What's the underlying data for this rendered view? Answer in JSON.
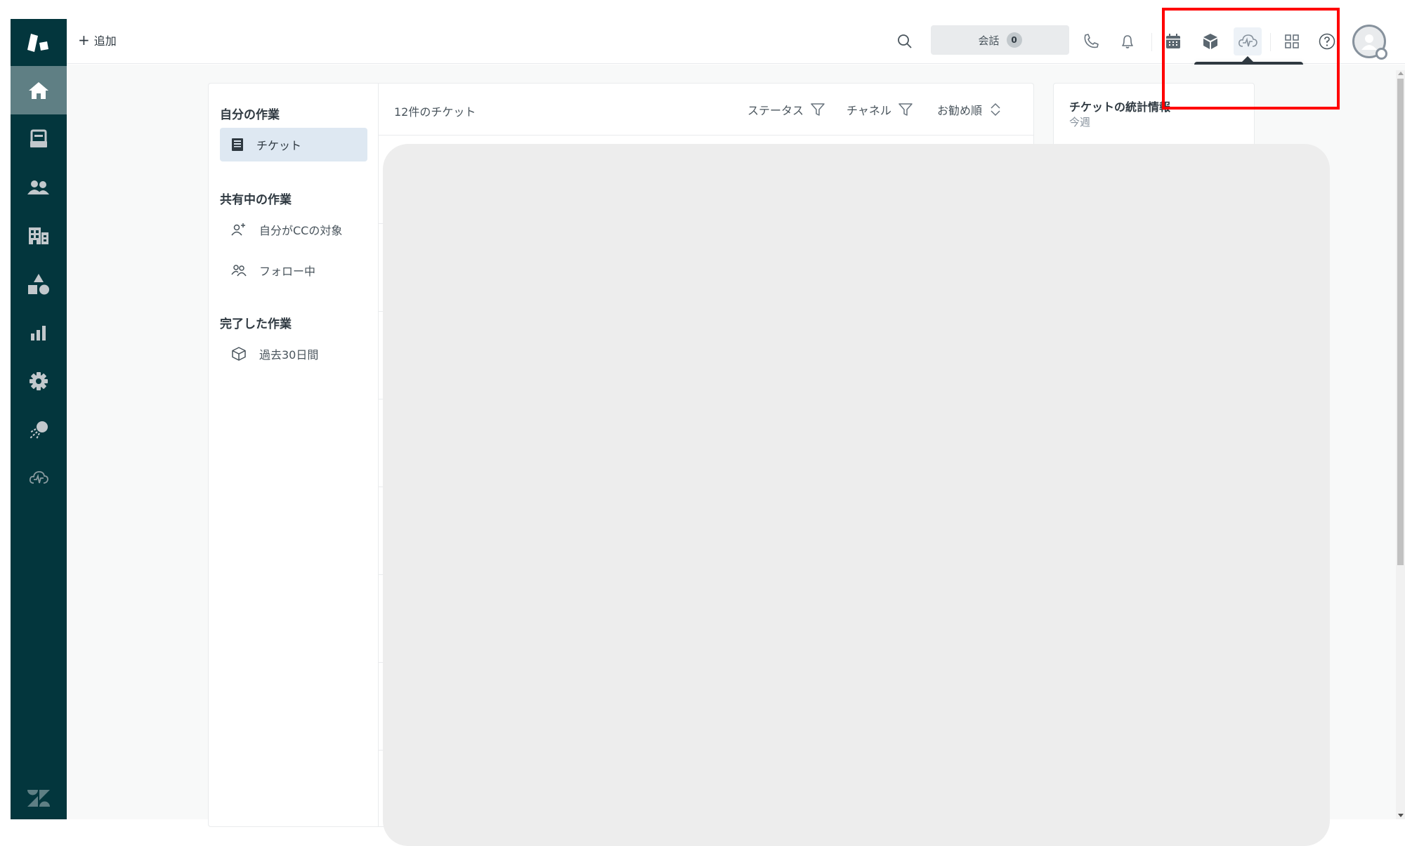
{
  "topbar": {
    "add_label": "追加",
    "conversations_label": "会話",
    "conversations_count": "0",
    "tooltip": "Amazon Connect"
  },
  "nav": {
    "items": [
      {
        "icon": "home-icon",
        "label": "Home",
        "active": true
      },
      {
        "icon": "tickets-icon",
        "label": "Tickets"
      },
      {
        "icon": "customers-icon",
        "label": "Customers"
      },
      {
        "icon": "organizations-icon",
        "label": "Organizations"
      },
      {
        "icon": "objects-icon",
        "label": "Objects"
      },
      {
        "icon": "reporting-icon",
        "label": "Reporting"
      },
      {
        "icon": "admin-icon",
        "label": "Admin"
      },
      {
        "icon": "app-icon",
        "label": "App"
      },
      {
        "icon": "amazon-connect-icon",
        "label": "Amazon Connect"
      }
    ]
  },
  "views": {
    "my_work": {
      "heading": "自分の作業",
      "items": [
        {
          "label": "チケット",
          "icon": "ticket-inbox-icon",
          "selected": true
        }
      ]
    },
    "shared_work": {
      "heading": "共有中の作業",
      "items": [
        {
          "label": "自分がCCの対象",
          "icon": "user-plus-icon"
        },
        {
          "label": "フォロー中",
          "icon": "users-icon"
        }
      ]
    },
    "completed_work": {
      "heading": "完了した作業",
      "items": [
        {
          "label": "過去30日間",
          "icon": "cube-outline-icon"
        }
      ]
    }
  },
  "tickets": {
    "count_label": "12件のチケット",
    "filters": [
      {
        "label": "ステータス",
        "icon": "filter-icon"
      },
      {
        "label": "チャネル",
        "icon": "filter-icon"
      },
      {
        "label": "お勧め順",
        "icon": "sort-icon"
      }
    ]
  },
  "stats": {
    "title": "チケットの統計情報",
    "period": "今週"
  },
  "colors": {
    "nav_bg": "#03363d",
    "nav_active": "#5f7f84",
    "selected_view": "#dee8f2",
    "annotation": "#ff0000",
    "tooltip_bg": "#2f3941"
  }
}
